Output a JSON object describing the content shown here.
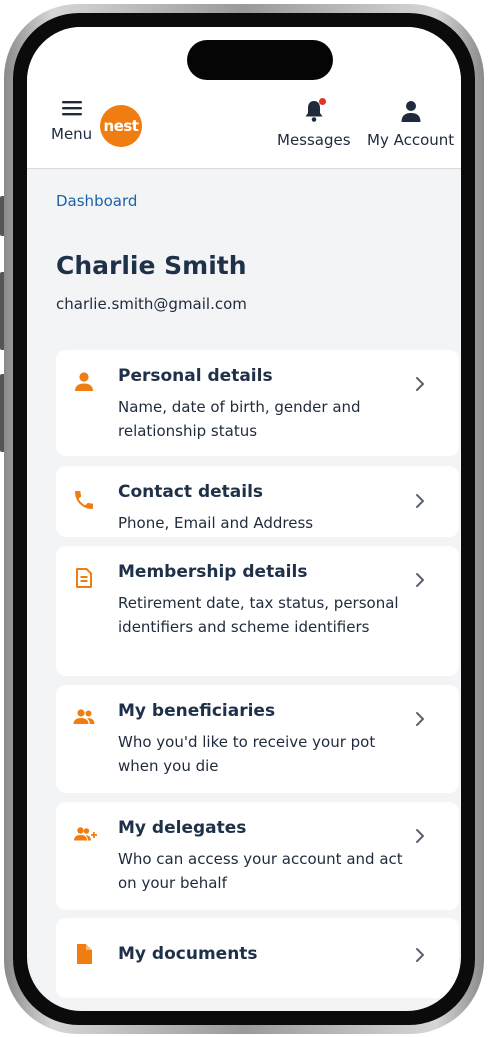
{
  "header": {
    "menu_label": "Menu",
    "logo_text": "nest",
    "messages_label": "Messages",
    "account_label": "My Account"
  },
  "breadcrumb": "Dashboard",
  "user": {
    "name": "Charlie Smith",
    "email": "charlie.smith@gmail.com"
  },
  "cards": [
    {
      "title": "Personal details",
      "desc": "Name, date of birth, gender and relationship status",
      "icon": "person-icon"
    },
    {
      "title": "Contact details",
      "desc": "Phone, Email and Address",
      "icon": "phone-icon"
    },
    {
      "title": "Membership details",
      "desc": "Retirement date, tax status, personal identifiers and scheme identifiers",
      "icon": "document-icon"
    },
    {
      "title": "My beneficiaries",
      "desc": "Who you'd like to receive your pot when you die",
      "icon": "people-icon"
    },
    {
      "title": "My delegates",
      "desc": "Who can access your account and act on your behalf",
      "icon": "people-add-icon"
    },
    {
      "title": "My documents",
      "desc": "",
      "icon": "file-icon"
    }
  ],
  "colors": {
    "accent": "#f07d12",
    "heading": "#1f3148",
    "link": "#1b62a8",
    "background": "#f3f4f6",
    "notification": "#e0332c"
  }
}
